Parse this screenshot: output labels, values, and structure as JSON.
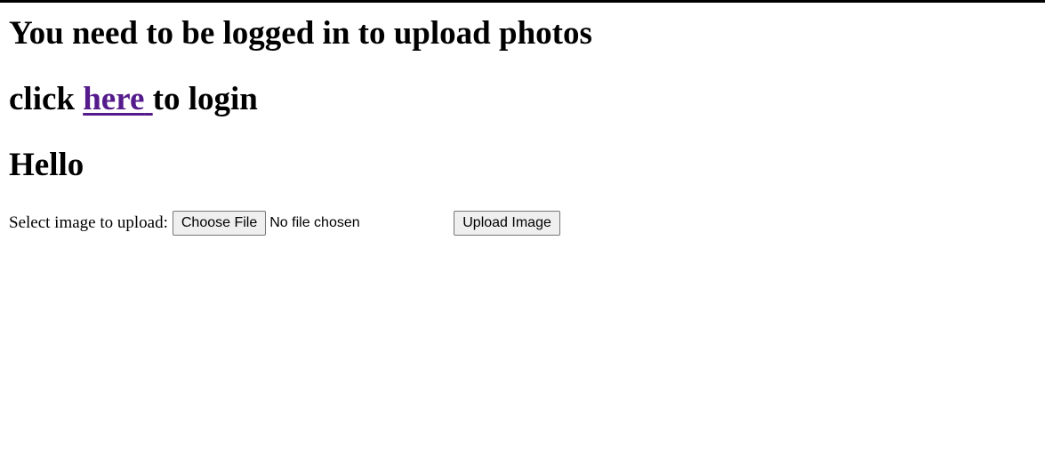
{
  "page": {
    "login_notice": "You need to be logged in to upload photos",
    "click_prefix": "click",
    "link_text": "here",
    "click_suffix": "to login",
    "greeting": "Hello"
  },
  "upload": {
    "label": "Select image to upload:",
    "choose_file_label": "Choose File",
    "file_status": "No file chosen",
    "submit_label": "Upload Image"
  },
  "colors": {
    "link_visited": "#551a8b",
    "button_bg": "#efefef",
    "button_border": "#767676"
  }
}
